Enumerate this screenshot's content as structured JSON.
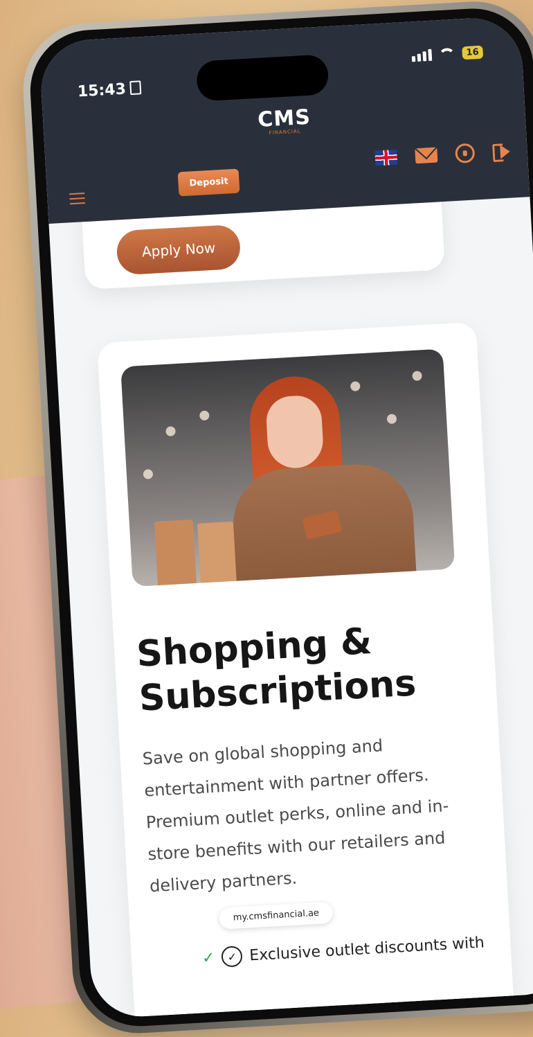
{
  "status_bar": {
    "time": "15:43",
    "battery": "16"
  },
  "header": {
    "logo": "CMS",
    "logo_sub": "FINANCIAL",
    "deposit_label": "Deposit"
  },
  "top_card": {
    "apply_label": "Apply Now"
  },
  "main_card": {
    "title": "Shopping & Subscriptions",
    "description": "Save on global shopping and entertainment with partner offers. Premium outlet perks, online and in-store benefits with our retailers and delivery partners.",
    "feature": "Exclusive outlet discounts with"
  },
  "browser": {
    "url": "my.cmsfinancial.ae"
  },
  "colors": {
    "accent": "#e07a3e",
    "header_bg": "#2a303b",
    "button_brown": "#b35e36"
  },
  "icons": [
    "menu-icon",
    "uk-flag-icon",
    "mail-icon",
    "support-headset-icon",
    "logout-icon",
    "check-icon"
  ]
}
